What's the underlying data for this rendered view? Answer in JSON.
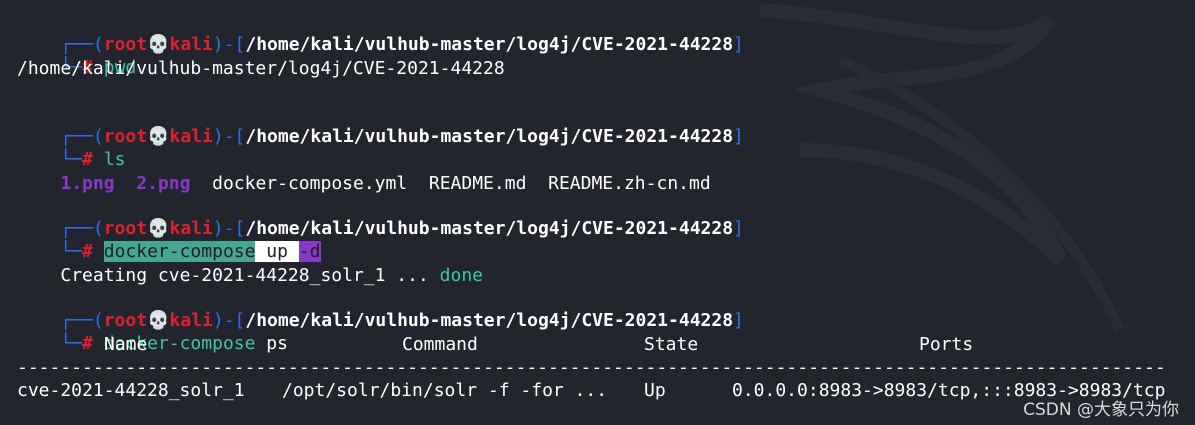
{
  "prompt": {
    "open": "┌──(",
    "user": "root",
    "skull": "💀",
    "host": "kali",
    "mid": ")-[",
    "path": "/home/kali/vulhub-master/log4j/CVE-2021-44228",
    "close": "]",
    "line2_prefix": "└─",
    "hash": "#"
  },
  "blocks": [
    {
      "command": "pwd",
      "output": "/home/kali/vulhub-master/log4j/CVE-2021-44228"
    },
    {
      "command": "ls",
      "files": [
        "1.png",
        "2.png",
        "docker-compose.yml",
        "README.md",
        "README.zh-cn.md"
      ]
    },
    {
      "command_parts": [
        "docker-compose",
        " up ",
        "-d"
      ],
      "output_prefix": "Creating cve-2021-44228_solr_1 ... ",
      "output_status": "done"
    },
    {
      "command_parts": [
        "docker-compose",
        " ps"
      ]
    }
  ],
  "ps_table": {
    "headers": [
      "Name",
      "Command",
      "State",
      "Ports"
    ],
    "separator": "----------------------------------------------------------------------------------------------------------",
    "rows": [
      [
        "cve-2021-44228_solr_1",
        "/opt/solr/bin/solr -f -for ...",
        "Up",
        "0.0.0.0:8983->8983/tcp,:::8983->8983/tcp"
      ]
    ]
  },
  "watermark": "CSDN @大象只为你",
  "colors": {
    "background": "#23252e",
    "user": "#e0202f",
    "bracket": "#2f6fed",
    "command": "#3ec6ab",
    "image_file": "#8a38c9"
  }
}
